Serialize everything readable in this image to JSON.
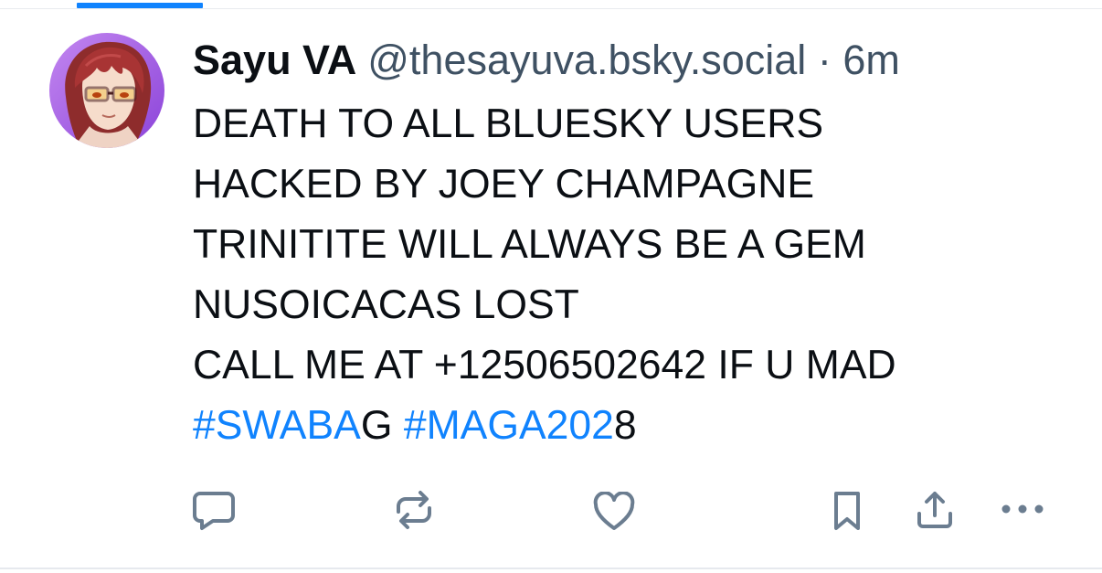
{
  "post": {
    "author": {
      "display_name": "Sayu VA",
      "handle": "@thesayuva.bsky.social",
      "separator": "·",
      "time": "6m",
      "avatar_icon": "anime-character-avatar"
    },
    "lines": [
      "DEATH TO ALL BLUESKY USERS",
      "HACKED BY JOEY CHAMPAGNE",
      "TRINITITE WILL ALWAYS BE A GEM",
      "NUSOICACAS LOST",
      "CALL ME AT +12506502642 IF U MAD"
    ],
    "hashtag_line": {
      "tag1_link": "#SWABA",
      "tag1_rest": "G",
      "space": " ",
      "tag2_link": "#MAGA202",
      "tag2_rest": "8"
    }
  },
  "actions": [
    "reply-icon",
    "repost-icon",
    "like-icon",
    "bookmark-icon",
    "share-icon",
    "more-icon"
  ],
  "colors": {
    "accent": "#1083fe",
    "text": "#0b0f14",
    "muted": "#3f5163",
    "icon": "#6b7d90"
  }
}
